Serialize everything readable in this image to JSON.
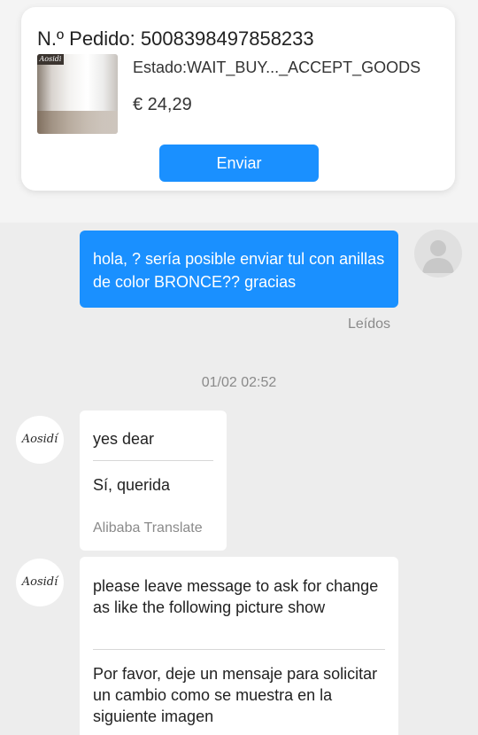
{
  "order": {
    "number": "N.º Pedido: 5008398497858233",
    "status": "Estado:WAIT_BUY..._ACCEPT_GOODS",
    "price": "€ 24,29",
    "send_label": "Enviar",
    "thumb_brand": "Aosidi"
  },
  "messages": {
    "outgoing": {
      "text": "hola, ? sería posible enviar tul con anillas de color BRONCE?? gracias",
      "read_status": "Leídos"
    },
    "timestamp": "01/02 02:52",
    "incoming": [
      {
        "avatar_label": "Aosidí",
        "original": "yes dear",
        "translated": "Sí, querida",
        "translator": "Alibaba Translate"
      },
      {
        "avatar_label": "Aosidí",
        "original": "please leave message to ask for change as like the following picture show",
        "translated": "Por favor, deje un mensaje para solicitar un cambio como se muestra en la siguiente imagen"
      }
    ]
  },
  "colors": {
    "accent": "#1a90ff",
    "background": "#ededed",
    "bubble_in": "#ffffff",
    "muted_text": "#8a8a8a"
  }
}
